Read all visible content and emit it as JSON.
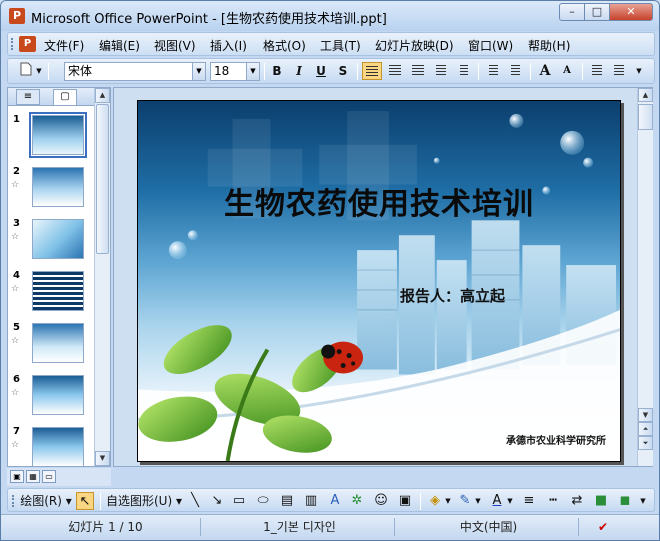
{
  "window": {
    "title": "Microsoft Office PowerPoint - [生物农药使用技术培训.ppt]",
    "app_icon": "P",
    "buttons": [
      "–",
      "□",
      "✕"
    ]
  },
  "menubar": {
    "items": [
      "文件(F)",
      "编辑(E)",
      "视图(V)",
      "插入(I)",
      "格式(O)",
      "工具(T)",
      "幻灯片放映(D)",
      "窗口(W)",
      "帮助(H)"
    ]
  },
  "toolbar": {
    "font_name": "宋体",
    "font_size": "18",
    "bold": "B",
    "italic": "I",
    "underline": "U",
    "shadow": "S",
    "grow": "A",
    "shrink": "A"
  },
  "left_pane": {
    "slide_numbers": [
      "1",
      "2",
      "3",
      "4",
      "5",
      "6",
      "7"
    ],
    "selected_slide": 1
  },
  "slide": {
    "title": "生物农药使用技术培训",
    "reporter": "报告人：高立起",
    "organization": "承德市农业科学研究所"
  },
  "drawing_toolbar": {
    "draw_label": "绘图(R)",
    "autoshapes_label": "自选图形(U)"
  },
  "statusbar": {
    "slide_info": "幻灯片 1 / 10",
    "design": "1_기본 디자인",
    "language": "中文(中国)"
  },
  "colors": {
    "accent_active": "#fbd682",
    "chrome": "#c4d9f1"
  }
}
